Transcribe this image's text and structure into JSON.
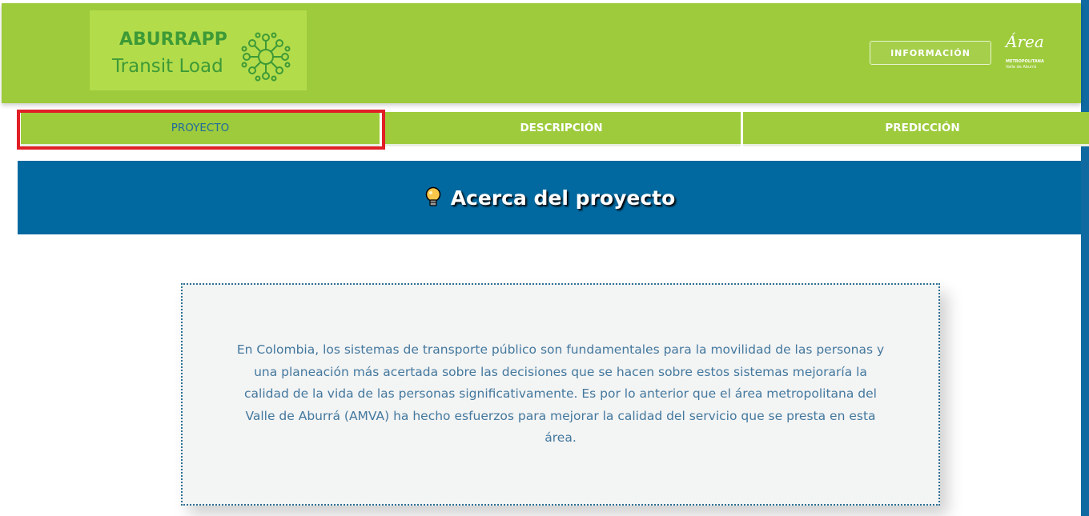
{
  "header": {
    "logo_title": "ABURRAPP",
    "logo_subtitle": "Transit Load",
    "info_button": "INFORMACIÓN",
    "area_logo": {
      "script": "Área",
      "line1": "METROPOLITANA",
      "line2": "Valle de Aburrá"
    }
  },
  "tabs": [
    {
      "label": "PROYECTO",
      "active": true
    },
    {
      "label": "DESCRIPCIÓN",
      "active": false
    },
    {
      "label": "PREDICCIÓN",
      "active": false
    }
  ],
  "banner": {
    "icon": "lightbulb-icon",
    "title": "Acerca del proyecto"
  },
  "card": {
    "text": "En Colombia, los sistemas de transporte público son fundamentales para la movilidad de las personas y una planeación más acertada sobre las decisiones que se hacen sobre estos sistemas mejoraría la calidad de la vida de las personas significativamente. Es por lo anterior que el área metropolitana del Valle de Aburrá (AMVA) ha hecho esfuerzos para mejorar la calidad del servicio que se presta en esta área."
  },
  "colors": {
    "header_green": "#9dcb3c",
    "banner_blue": "#01699f",
    "highlight_red": "#e11f26"
  }
}
